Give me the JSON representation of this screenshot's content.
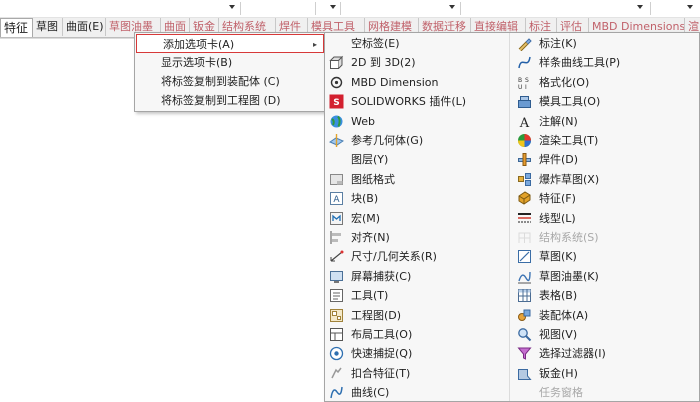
{
  "tabs": [
    {
      "label": "特征",
      "state": "active"
    },
    {
      "label": "草图",
      "state": "normal"
    },
    {
      "label": "曲面(E)",
      "state": "normal"
    },
    {
      "label": "草图油墨",
      "state": "dim"
    },
    {
      "label": "曲面",
      "state": "dim"
    },
    {
      "label": "钣金",
      "state": "dim"
    },
    {
      "label": "结构系统",
      "state": "dim"
    },
    {
      "label": "焊件",
      "state": "dim"
    },
    {
      "label": "模具工具",
      "state": "dim"
    },
    {
      "label": "网格建模",
      "state": "dim"
    },
    {
      "label": "数据迁移",
      "state": "dim"
    },
    {
      "label": "直接编辑",
      "state": "dim"
    },
    {
      "label": "标注",
      "state": "dim"
    },
    {
      "label": "评估",
      "state": "dim"
    },
    {
      "label": "MBD Dimensions",
      "state": "dim"
    },
    {
      "label": "渲",
      "state": "dim"
    }
  ],
  "context_menu": {
    "items": [
      {
        "label": "添加选项卡(A)",
        "highlighted": true,
        "submenu": true
      },
      {
        "label": "显示选项卡(B)"
      },
      {
        "label": "将标签复制到装配体 (C)"
      },
      {
        "label": "将标签复制到工程图 (D)"
      }
    ]
  },
  "submenu": {
    "left": [
      {
        "label": "空标签(E)",
        "icon": "blank-icon"
      },
      {
        "label": "2D 到 3D(2)",
        "icon": "2d-to-3d-icon"
      },
      {
        "label": "MBD Dimension",
        "icon": "mbd-icon"
      },
      {
        "label": "SOLIDWORKS 插件(L)",
        "icon": "solidworks-addin-icon"
      },
      {
        "label": "Web",
        "icon": "web-icon"
      },
      {
        "label": "参考几何体(G)",
        "icon": "reference-geometry-icon"
      },
      {
        "label": "图层(Y)",
        "icon": "blank-icon"
      },
      {
        "label": "图纸格式",
        "icon": "sheet-format-icon"
      },
      {
        "label": "块(B)",
        "icon": "block-icon"
      },
      {
        "label": "宏(M)",
        "icon": "macro-icon"
      },
      {
        "label": "对齐(N)",
        "icon": "align-icon"
      },
      {
        "label": "尺寸/几何关系(R)",
        "icon": "dimension-relation-icon"
      },
      {
        "label": "屏幕捕获(C)",
        "icon": "screen-capture-icon"
      },
      {
        "label": "工具(T)",
        "icon": "tools-icon"
      },
      {
        "label": "工程图(D)",
        "icon": "drawing-icon"
      },
      {
        "label": "布局工具(O)",
        "icon": "layout-tools-icon"
      },
      {
        "label": "快速捕捉(Q)",
        "icon": "quick-snap-icon"
      },
      {
        "label": "扣合特征(T)",
        "icon": "fastening-feature-icon"
      },
      {
        "label": "曲线(C)",
        "icon": "curve-icon"
      }
    ],
    "right": [
      {
        "label": "标注(K)",
        "icon": "annotation-icon"
      },
      {
        "label": "样条曲线工具(P)",
        "icon": "spline-icon"
      },
      {
        "label": "格式化(O)",
        "icon": "format-icon"
      },
      {
        "label": "模具工具(O)",
        "icon": "mold-tools-icon"
      },
      {
        "label": "注解(N)",
        "icon": "note-icon"
      },
      {
        "label": "渲染工具(T)",
        "icon": "render-icon"
      },
      {
        "label": "焊件(D)",
        "icon": "weldment-icon"
      },
      {
        "label": "爆炸草图(X)",
        "icon": "explode-sketch-icon"
      },
      {
        "label": "特征(F)",
        "icon": "features-icon"
      },
      {
        "label": "线型(L)",
        "icon": "line-format-icon"
      },
      {
        "label": "结构系统(S)",
        "icon": "structure-system-icon",
        "disabled": true
      },
      {
        "label": "草图(K)",
        "icon": "sketch-icon"
      },
      {
        "label": "草图油墨(K)",
        "icon": "sketch-ink-icon"
      },
      {
        "label": "表格(B)",
        "icon": "table-icon"
      },
      {
        "label": "装配体(A)",
        "icon": "assembly-icon"
      },
      {
        "label": "视图(V)",
        "icon": "view-icon"
      },
      {
        "label": "选择过滤器(I)",
        "icon": "selection-filter-icon"
      },
      {
        "label": "钣金(H)",
        "icon": "sheet-metal-icon"
      },
      {
        "label": "任务窗格",
        "icon": "blank-icon",
        "disabled": true
      }
    ]
  },
  "colors": {
    "highlight_border": "#d73939",
    "dim_tab_text": "#c0616a",
    "menu_bg": "#f7f7f7"
  }
}
